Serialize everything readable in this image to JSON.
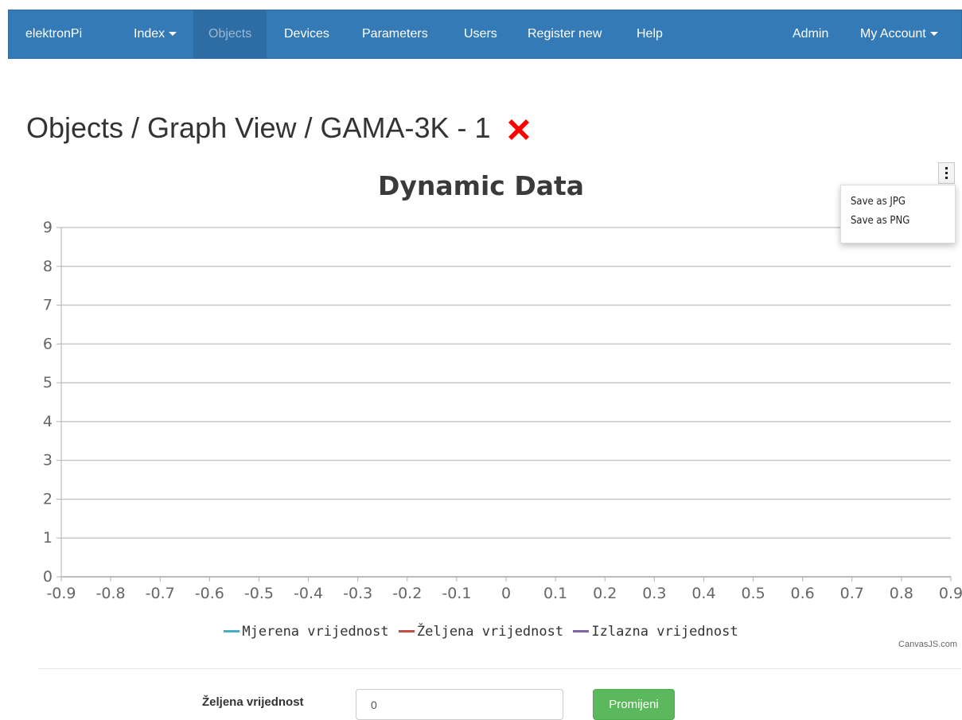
{
  "navbar": {
    "brand": "elektronPi",
    "items": [
      {
        "label": "Index",
        "dropdown": true
      },
      {
        "label": "Objects",
        "active": true
      },
      {
        "label": "Devices"
      },
      {
        "label": "Parameters"
      },
      {
        "label": "Users"
      },
      {
        "label": "Register new"
      },
      {
        "label": "Help"
      }
    ],
    "right": [
      {
        "label": "Admin"
      },
      {
        "label": "My Account",
        "dropdown": true
      }
    ],
    "color": "#337ab7"
  },
  "page": {
    "title": "Objects / Graph View / GAMA-3K - 1",
    "title_icon": "close-x-icon",
    "title_icon_color": "#ff0000"
  },
  "chart_menu": {
    "icon": "more-vertical-icon",
    "items": [
      "Save as JPG",
      "Save as PNG"
    ]
  },
  "chart_credit": "CanvasJS.com",
  "chart_data": {
    "type": "line",
    "title": "Dynamic Data",
    "xlabel": "",
    "ylabel": "",
    "x_ticks": [
      "-0.9",
      "-0.8",
      "-0.7",
      "-0.6",
      "-0.5",
      "-0.4",
      "-0.3",
      "-0.2",
      "-0.1",
      "0",
      "0.1",
      "0.2",
      "0.3",
      "0.4",
      "0.5",
      "0.6",
      "0.7",
      "0.8",
      "0.9"
    ],
    "y_ticks": [
      "0",
      "1",
      "2",
      "3",
      "4",
      "5",
      "6",
      "7",
      "8",
      "9"
    ],
    "xlim": [
      -0.9,
      0.9
    ],
    "ylim": [
      0,
      9
    ],
    "grid": true,
    "legend_position": "bottom",
    "series": [
      {
        "name": "Mjerena vrijednost",
        "color": "#4bacc6",
        "values": []
      },
      {
        "name": "Željena vrijednost",
        "color": "#c0504d",
        "values": []
      },
      {
        "name": "Izlazna vrijednost",
        "color": "#8064a2",
        "values": []
      }
    ]
  },
  "form": {
    "label": "Željena vrijednost",
    "input_value": "0",
    "button_label": "Promijeni",
    "button_color": "#5cb85c"
  }
}
